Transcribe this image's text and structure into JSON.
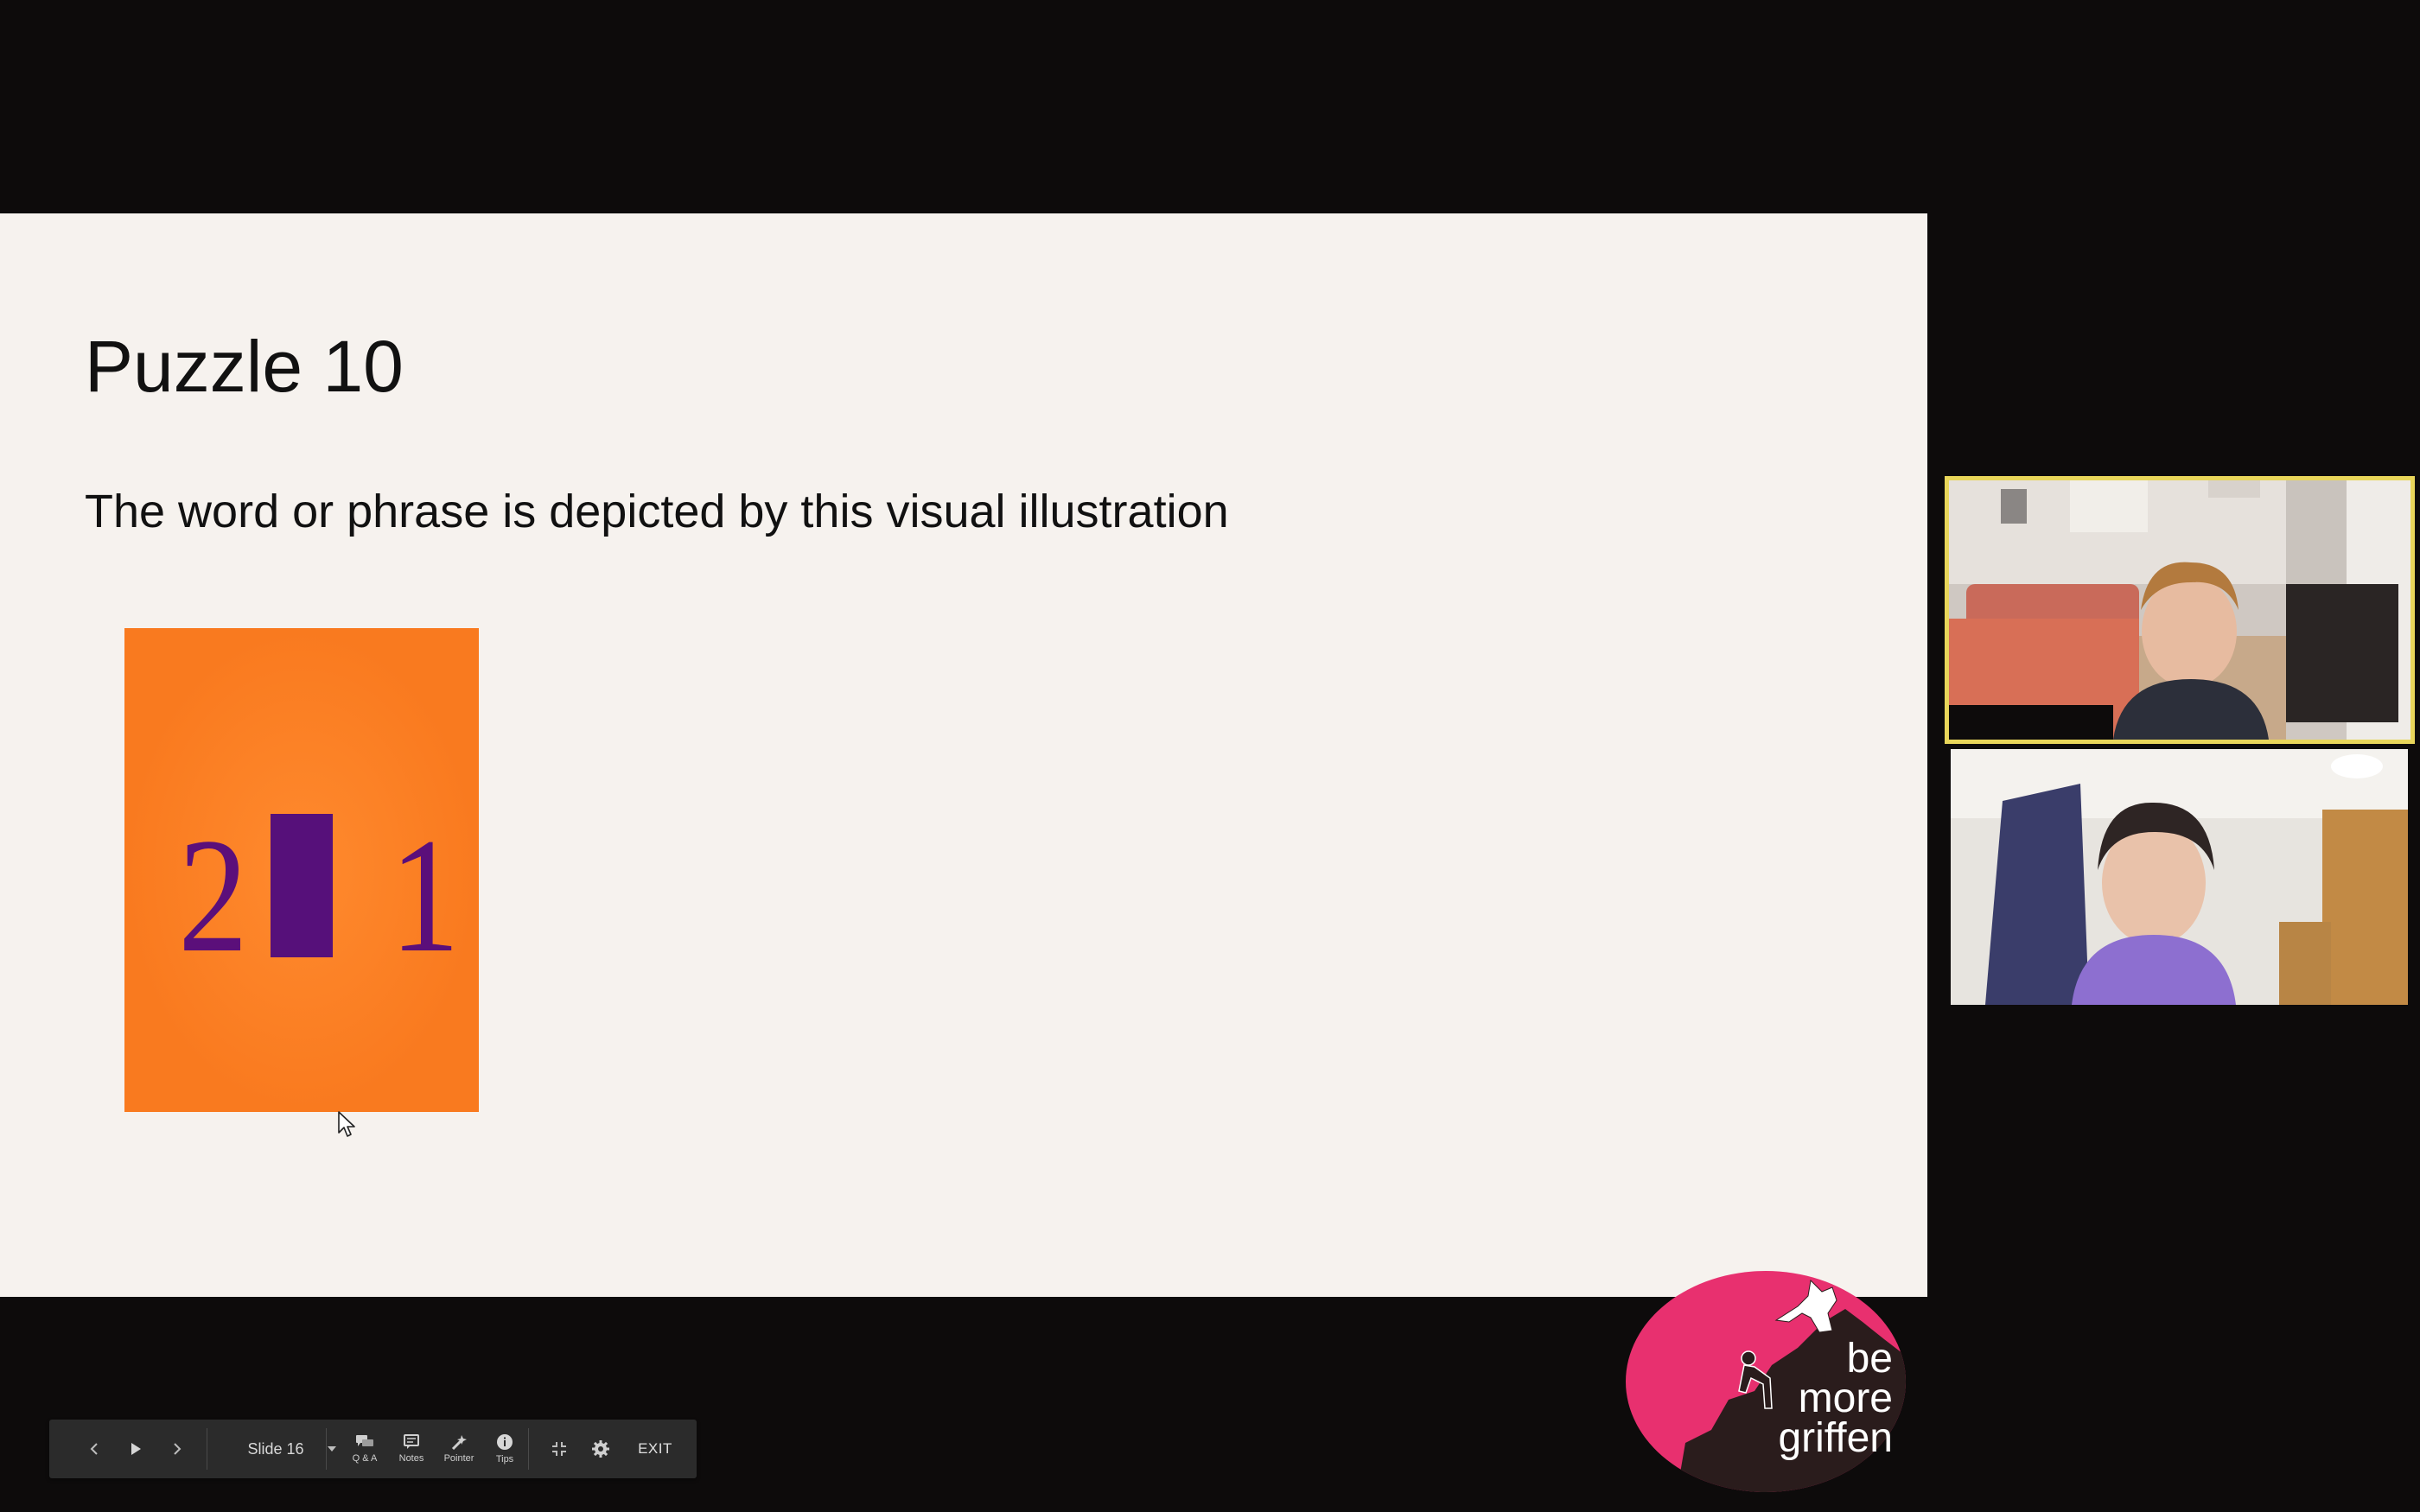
{
  "slide": {
    "title": "Puzzle 10",
    "subtitle": "The word or phrase is depicted by this visual illustration",
    "puzzle": {
      "left_text": "2",
      "right_text": "1",
      "background_color": "#fb7c20",
      "glyph_color": "#5b0f7a"
    }
  },
  "toolbar": {
    "slide_label": "Slide 16",
    "qa_label": "Q & A",
    "notes_label": "Notes",
    "pointer_label": "Pointer",
    "tips_label": "Tips",
    "exit_label": "EXIT"
  },
  "logo": {
    "lines": [
      "be",
      "more",
      "griffen"
    ],
    "color": "#e8306f"
  },
  "participants": {
    "active_speaker_border": "#e8d65a"
  }
}
